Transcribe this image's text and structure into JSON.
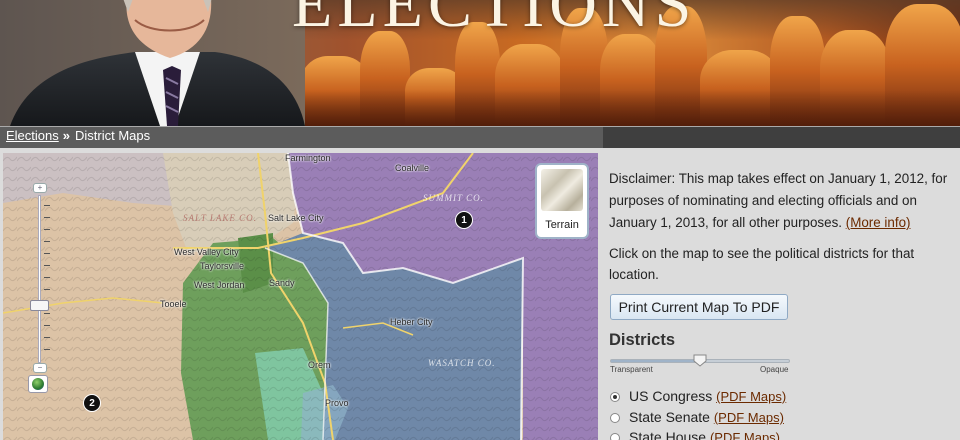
{
  "banner": {
    "title": "ELECTIONS"
  },
  "breadcrumb": {
    "home_label": "Elections",
    "separator": "»",
    "current": "District Maps"
  },
  "map": {
    "towns": [
      "Farmington",
      "Coalville",
      "Salt Lake City",
      "West Valley City",
      "Taylorsville",
      "West Jordan",
      "Sandy",
      "Tooele",
      "Heber City",
      "Orem",
      "Provo"
    ],
    "counties": [
      "SUMMIT CO.",
      "SALT LAKE CO.",
      "WASATCH CO."
    ],
    "district_markers": [
      "1",
      "2"
    ],
    "terrain_button": "Terrain",
    "zoom_in": "+",
    "zoom_out": "−",
    "colors": {
      "district_1": "#9a7fb6",
      "district_2": "#dcc3a6",
      "district_3": "#6f88a8",
      "district_4": "#6e9f5c"
    }
  },
  "panel": {
    "disclaimer_text": "Disclaimer: This map takes effect on January 1, 2012, for purposes of nominating and electing officials and on January 1, 2013, for all other purposes.",
    "more_info": "(More info)",
    "instruction": "Click on the map to see the political districts for that location.",
    "print_button": "Print Current Map To PDF",
    "districts_title": "Districts",
    "opacity": {
      "min_label": "Transparent",
      "max_label": "Opaque",
      "value": 0.5
    },
    "options": [
      {
        "label": "US Congress",
        "link": "(PDF Maps)",
        "selected": true
      },
      {
        "label": "State Senate",
        "link": "(PDF Maps)",
        "selected": false
      },
      {
        "label": "State House",
        "link": "(PDF Maps)",
        "selected": false
      }
    ]
  }
}
